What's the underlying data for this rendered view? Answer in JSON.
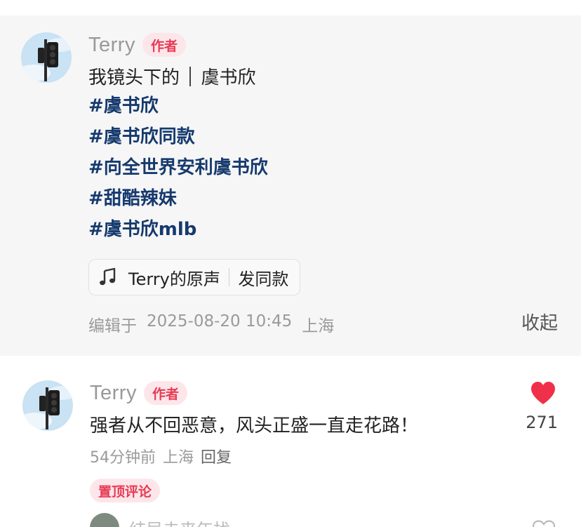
{
  "post": {
    "author_name": "Terry",
    "author_badge": "作者",
    "title_left": "我镜头下的",
    "title_right": "虞书欣",
    "hashtags": [
      "#虞书欣",
      "#虞书欣同款",
      "#向全世界安利虞书欣",
      "#甜酷辣妹",
      "#虞书欣mlb"
    ],
    "sound_name": "Terry的原声",
    "sound_action": "发同款",
    "edited_label": "编辑于",
    "edited_time": "2025-08-20 10:45",
    "location": "上海",
    "collapse_label": "收起"
  },
  "comment": {
    "author_name": "Terry",
    "author_badge": "作者",
    "text": "强者从不回恶意，风头正盛一直走花路！",
    "time_ago": "54分钟前",
    "location": "上海",
    "reply_label": "回复",
    "pinned_label": "置顶评论",
    "like_count": "271",
    "liked": true
  },
  "next_comment": {
    "author_name": "结局未来年找"
  },
  "icons": {
    "music": "music-note-icon",
    "like": "heart-filled-icon",
    "next_like": "heart-outline-icon"
  },
  "colors": {
    "hashtag": "#163a6e",
    "badge_bg": "#fde6ea",
    "badge_text": "#e83b54",
    "like": "#f0304a",
    "card_bg": "#f6f6f6"
  }
}
